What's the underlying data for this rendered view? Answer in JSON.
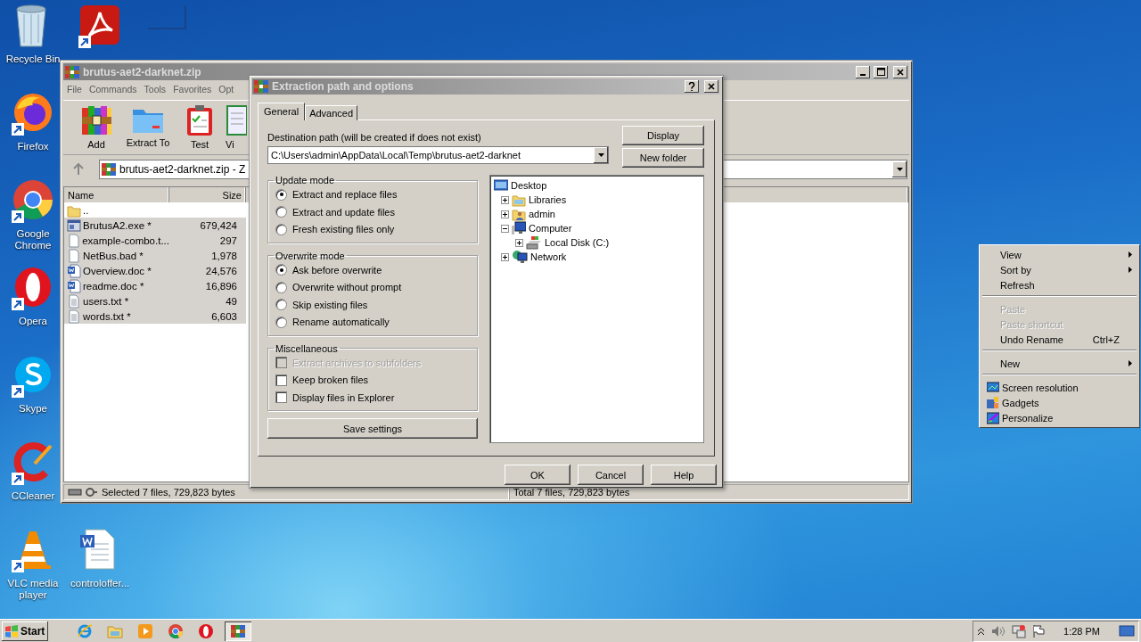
{
  "desktop_icons": [
    {
      "label": "Recycle Bin",
      "kind": "recycle",
      "shortcut": false
    },
    {
      "kind": "acrobat",
      "shortcut": true
    },
    {
      "kind": "image",
      "shortcut": false
    },
    {
      "label": "Firefox",
      "kind": "firefox",
      "shortcut": true
    },
    {
      "label": "Google Chrome",
      "kind": "chrome",
      "shortcut": true
    },
    {
      "label": "Opera",
      "kind": "opera",
      "shortcut": true
    },
    {
      "label": "Skype",
      "kind": "skype",
      "shortcut": true
    },
    {
      "label": "CCleaner",
      "kind": "ccleaner",
      "shortcut": true
    },
    {
      "label": "VLC media player",
      "kind": "vlc",
      "shortcut": true
    },
    {
      "label": "controloffer...",
      "kind": "word",
      "shortcut": false
    }
  ],
  "archive_window": {
    "title": "brutus-aet2-darknet.zip",
    "menu": [
      "File",
      "Commands",
      "Tools",
      "Favorites",
      "Opt"
    ],
    "toolbar": [
      {
        "label": "Add",
        "kind": "add"
      },
      {
        "label": "Extract To",
        "kind": "extract"
      },
      {
        "label": "Test",
        "kind": "test"
      },
      {
        "label": "Vi",
        "kind": "view"
      }
    ],
    "address": "brutus-aet2-darknet.zip - Z",
    "columns": [
      "Name",
      "Size"
    ],
    "rows": [
      {
        "name": "..",
        "kind": "folder",
        "selected": false
      },
      {
        "name": "BrutusA2.exe *",
        "size": "679,424",
        "kind": "exe",
        "selected": true
      },
      {
        "name": "example-combo.t...",
        "size": "297",
        "kind": "file",
        "selected": true
      },
      {
        "name": "NetBus.bad *",
        "size": "1,978",
        "kind": "file",
        "selected": true
      },
      {
        "name": "Overview.doc *",
        "size": "24,576",
        "kind": "doc",
        "selected": true
      },
      {
        "name": "readme.doc *",
        "size": "16,896",
        "kind": "doc",
        "selected": true
      },
      {
        "name": "users.txt *",
        "size": "49",
        "kind": "text",
        "selected": true
      },
      {
        "name": "words.txt *",
        "size": "6,603",
        "kind": "text",
        "selected": true
      }
    ],
    "status_left": "Selected 7 files, 729,823 bytes",
    "status_right": "Total 7 files, 729,823 bytes"
  },
  "dialog": {
    "title": "Extraction path and options",
    "tabs": [
      {
        "label": "General",
        "selected": true
      },
      {
        "label": "Advanced",
        "selected": false
      }
    ],
    "path_label": "Destination path (will be created if does not exist)",
    "path": "C:\\Users\\admin\\AppData\\Local\\Temp\\brutus-aet2-darknet",
    "side_buttons": [
      "Display",
      "New folder"
    ],
    "update_mode": {
      "title": "Update mode",
      "options": [
        {
          "label": "Extract and replace files",
          "selected": true
        },
        {
          "label": "Extract and update files",
          "selected": false
        },
        {
          "label": "Fresh existing files only",
          "selected": false
        }
      ]
    },
    "overwrite_mode": {
      "title": "Overwrite mode",
      "options": [
        {
          "label": "Ask before overwrite",
          "selected": true
        },
        {
          "label": "Overwrite without prompt",
          "selected": false
        },
        {
          "label": "Skip existing files",
          "selected": false
        },
        {
          "label": "Rename automatically",
          "selected": false
        }
      ]
    },
    "miscellaneous": {
      "title": "Miscellaneous",
      "options": [
        {
          "label": "Extract archives to subfolders",
          "checked": false,
          "disabled": true
        },
        {
          "label": "Keep broken files",
          "checked": false,
          "disabled": false
        },
        {
          "label": "Display files in Explorer",
          "checked": false,
          "disabled": false
        }
      ]
    },
    "save_button": "Save settings",
    "tree": [
      {
        "label": "Desktop",
        "kind": "desktop",
        "children": [
          {
            "label": "Libraries",
            "kind": "folder",
            "expanded": false
          },
          {
            "label": "admin",
            "kind": "user",
            "expanded": false
          },
          {
            "label": "Computer",
            "kind": "computer",
            "expanded": true,
            "children": [
              {
                "label": "Local Disk (C:)",
                "kind": "drive",
                "expanded": false
              }
            ]
          },
          {
            "label": "Network",
            "kind": "network",
            "expanded": false
          }
        ]
      }
    ],
    "buttons": [
      "OK",
      "Cancel",
      "Help"
    ]
  },
  "context_menu": [
    {
      "kind": "item",
      "label": "View",
      "submenu": true,
      "disabled": false
    },
    {
      "kind": "item",
      "label": "Sort by",
      "submenu": true,
      "disabled": false
    },
    {
      "kind": "item",
      "label": "Refresh",
      "submenu": false,
      "disabled": false
    },
    {
      "kind": "separator"
    },
    {
      "kind": "item",
      "label": "Paste",
      "submenu": false,
      "disabled": true
    },
    {
      "kind": "item",
      "label": "Paste shortcut",
      "submenu": false,
      "disabled": true
    },
    {
      "kind": "item",
      "label": "Undo Rename",
      "shortcut": "Ctrl+Z",
      "submenu": false,
      "disabled": false
    },
    {
      "kind": "separator"
    },
    {
      "kind": "item",
      "label": "New",
      "submenu": true,
      "disabled": false
    },
    {
      "kind": "separator"
    },
    {
      "kind": "display",
      "label": "Screen resolution",
      "submenu": false,
      "disabled": false
    },
    {
      "kind": "gadgets",
      "label": "Gadgets",
      "submenu": false,
      "disabled": false
    },
    {
      "kind": "personalize",
      "label": "Personalize",
      "submenu": false,
      "disabled": false
    }
  ],
  "taskbar": {
    "start": "Start",
    "buttons": [
      {
        "kind": "ie",
        "selected": false
      },
      {
        "kind": "explorer",
        "selected": false
      },
      {
        "kind": "media",
        "selected": false
      },
      {
        "kind": "chrome",
        "selected": false
      },
      {
        "kind": "opera",
        "selected": false
      },
      {
        "kind": "winrar",
        "selected": true
      }
    ],
    "clock": "1:28 PM"
  }
}
